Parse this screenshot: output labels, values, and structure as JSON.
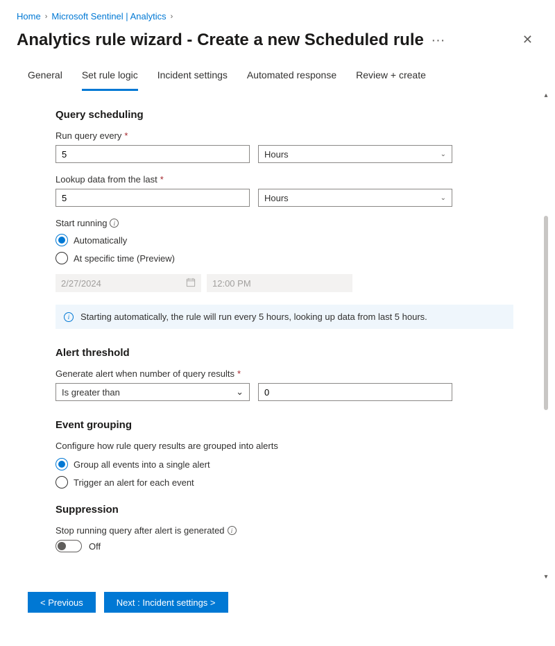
{
  "breadcrumb": {
    "home": "Home",
    "sentinel": "Microsoft Sentinel | Analytics"
  },
  "header": {
    "title": "Analytics rule wizard - Create a new Scheduled rule"
  },
  "tabs": {
    "general": "General",
    "set_rule_logic": "Set rule logic",
    "incident_settings": "Incident settings",
    "automated_response": "Automated response",
    "review_create": "Review + create"
  },
  "scheduling": {
    "section_title": "Query scheduling",
    "run_every_label": "Run query every",
    "run_every_value": "5",
    "run_every_unit": "Hours",
    "lookup_label": "Lookup data from the last",
    "lookup_value": "5",
    "lookup_unit": "Hours",
    "start_running_label": "Start running",
    "auto_label": "Automatically",
    "specific_label": "At specific time (Preview)",
    "date_value": "2/27/2024",
    "time_value": "12:00 PM",
    "banner_text": "Starting automatically, the rule will run every 5 hours, looking up data from last 5 hours."
  },
  "threshold": {
    "section_title": "Alert threshold",
    "label": "Generate alert when number of query results",
    "operator": "Is greater than",
    "value": "0"
  },
  "grouping": {
    "section_title": "Event grouping",
    "desc": "Configure how rule query results are grouped into alerts",
    "opt_single": "Group all events into a single alert",
    "opt_each": "Trigger an alert for each event"
  },
  "suppression": {
    "section_title": "Suppression",
    "label": "Stop running query after alert is generated",
    "state": "Off"
  },
  "footer": {
    "prev": "< Previous",
    "next": "Next : Incident settings >"
  }
}
